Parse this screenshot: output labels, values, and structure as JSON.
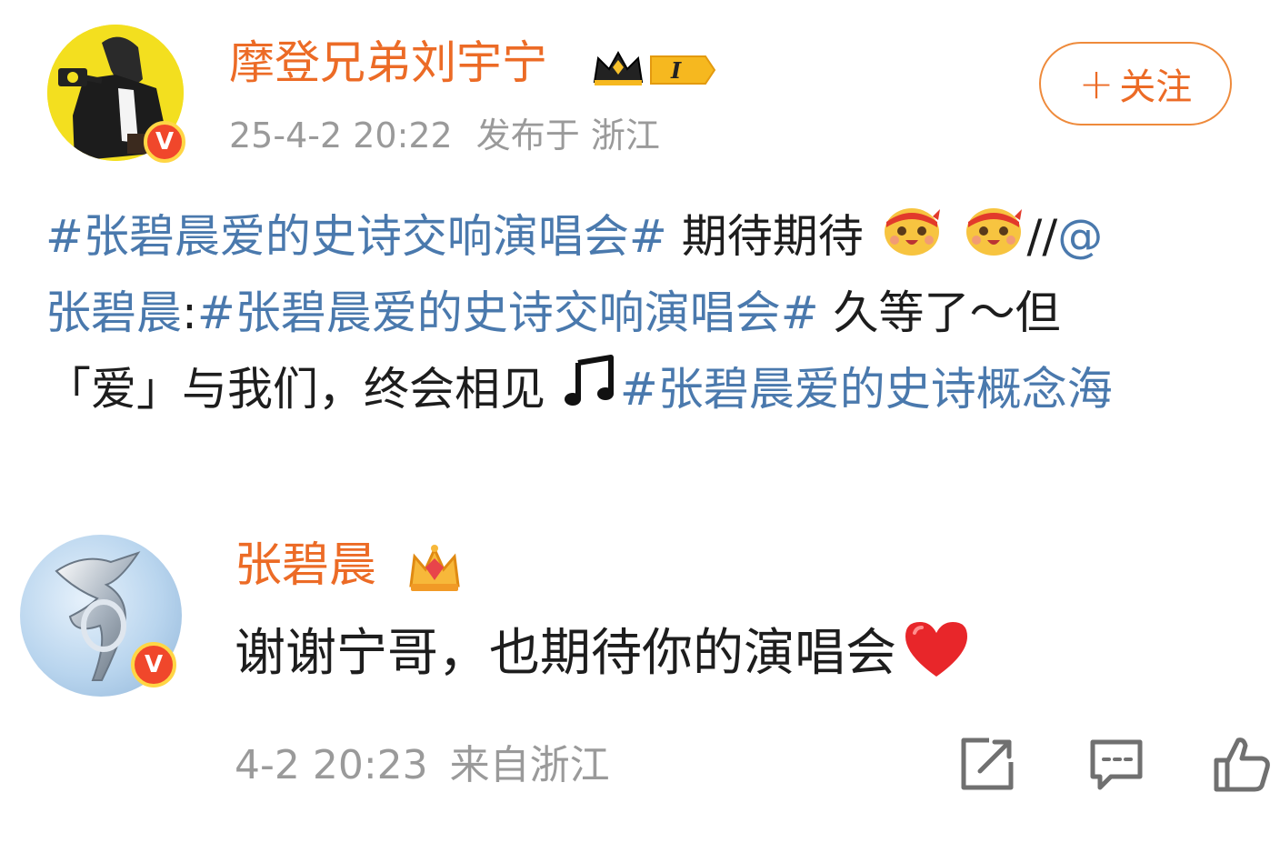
{
  "post": {
    "author": "摩登兄弟刘宇宁",
    "timestamp": "25-4-2 20:22",
    "location": "发布于 浙江",
    "follow_label": "关注",
    "follow_plus": "+",
    "badge_text": "I",
    "verified_mark": "V",
    "body": {
      "tag1": "#张碧晨爱的史诗交响演唱会#",
      "text1": " 期待期待",
      "repost_sep": "//",
      "mention": "@张碧晨",
      "colon": ":",
      "tag2": "#张碧晨爱的史诗交响演唱会#",
      "text2": " 久等了～但",
      "text3": "「爱」与我们，终会相见",
      "tag3": "#张碧晨爱的史诗概念海",
      "mention_line1": "@",
      "mention_line2": "张碧晨"
    },
    "emojis": [
      "cheer-emoji",
      "cheer-emoji",
      "music-note-emoji"
    ]
  },
  "comment": {
    "author": "张碧晨",
    "verified_mark": "V",
    "text": "谢谢宁哥，也期待你的演唱会",
    "timestamp": "4-2 20:23",
    "location": "来自浙江",
    "emoji": "red-heart-emoji"
  },
  "actions": [
    "share-icon",
    "comment-icon",
    "like-icon"
  ],
  "colors": {
    "username": "#ec6b26",
    "hashtag": "#4a79ad",
    "meta": "#9a9a9a",
    "text": "#1d1d1d",
    "follow_border": "#ee8a3b"
  }
}
